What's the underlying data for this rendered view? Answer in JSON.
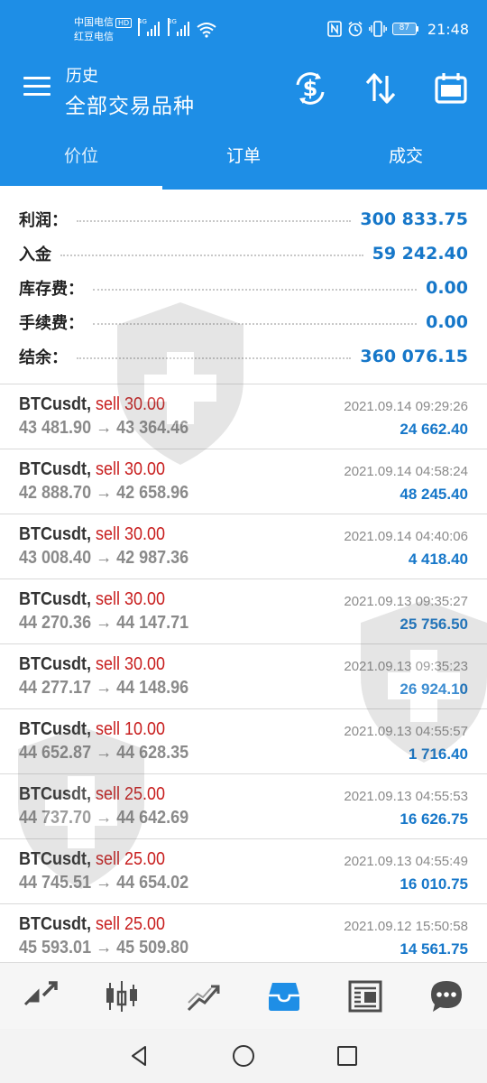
{
  "status_bar": {
    "carrier_1": "中国电信",
    "carrier_1_badge": "HD",
    "carrier_2": "红豆电信",
    "network_1": "4G",
    "network_2": "3G",
    "battery": "87",
    "time": "21:48",
    "icons": [
      "nfc-icon",
      "alarm-icon",
      "vibrate-icon",
      "wifi-icon"
    ]
  },
  "app_bar": {
    "subtitle": "历史",
    "title": "全部交易品种",
    "actions": [
      "currency-exchange-icon",
      "sort-icon",
      "calendar-icon"
    ]
  },
  "tabs": [
    {
      "label": "价位",
      "active": true
    },
    {
      "label": "订单",
      "active": false
    },
    {
      "label": "成交",
      "active": false
    }
  ],
  "summary": [
    {
      "label": "利润：",
      "value": "300 833.75"
    },
    {
      "label": "入金",
      "value": "59 242.40"
    },
    {
      "label": "库存费：",
      "value": "0.00"
    },
    {
      "label": "手续费：",
      "value": "0.00"
    },
    {
      "label": "结余：",
      "value": "360 076.15"
    }
  ],
  "deals": [
    {
      "symbol": "BTCusdt,",
      "side": "sell 30.00",
      "open": "43 481.90",
      "close": "43 364.46",
      "time": "2021.09.14 09:29:26",
      "profit": "24 662.40"
    },
    {
      "symbol": "BTCusdt,",
      "side": "sell 30.00",
      "open": "42 888.70",
      "close": "42 658.96",
      "time": "2021.09.14 04:58:24",
      "profit": "48 245.40"
    },
    {
      "symbol": "BTCusdt,",
      "side": "sell 30.00",
      "open": "43 008.40",
      "close": "42 987.36",
      "time": "2021.09.14 04:40:06",
      "profit": "4 418.40"
    },
    {
      "symbol": "BTCusdt,",
      "side": "sell 30.00",
      "open": "44 270.36",
      "close": "44 147.71",
      "time": "2021.09.13 09:35:27",
      "profit": "25 756.50"
    },
    {
      "symbol": "BTCusdt,",
      "side": "sell 30.00",
      "open": "44 277.17",
      "close": "44 148.96",
      "time": "2021.09.13 09:35:23",
      "profit": "26 924.10"
    },
    {
      "symbol": "BTCusdt,",
      "side": "sell 10.00",
      "open": "44 652.87",
      "close": "44 628.35",
      "time": "2021.09.13 04:55:57",
      "profit": "1 716.40"
    },
    {
      "symbol": "BTCusdt,",
      "side": "sell 25.00",
      "open": "44 737.70",
      "close": "44 642.69",
      "time": "2021.09.13 04:55:53",
      "profit": "16 626.75"
    },
    {
      "symbol": "BTCusdt,",
      "side": "sell 25.00",
      "open": "44 745.51",
      "close": "44 654.02",
      "time": "2021.09.13 04:55:49",
      "profit": "16 010.75"
    },
    {
      "symbol": "BTCusdt,",
      "side": "sell 25.00",
      "open": "45 593.01",
      "close": "45 509.80",
      "time": "2021.09.12 15:50:58",
      "profit": "14 561.75"
    }
  ],
  "arrow": "→",
  "bottom_nav": [
    {
      "icon": "quotes-icon",
      "active": false
    },
    {
      "icon": "chart-icon",
      "active": false
    },
    {
      "icon": "trade-icon",
      "active": false
    },
    {
      "icon": "history-icon",
      "active": true
    },
    {
      "icon": "news-icon",
      "active": false
    },
    {
      "icon": "chat-icon",
      "active": false
    }
  ],
  "system_nav": [
    "back-icon",
    "home-icon",
    "recents-icon"
  ],
  "colors": {
    "primary": "#1e8ee6",
    "value_blue": "#1677c9",
    "sell_red": "#c81e1e",
    "muted": "#8a8a8a"
  }
}
